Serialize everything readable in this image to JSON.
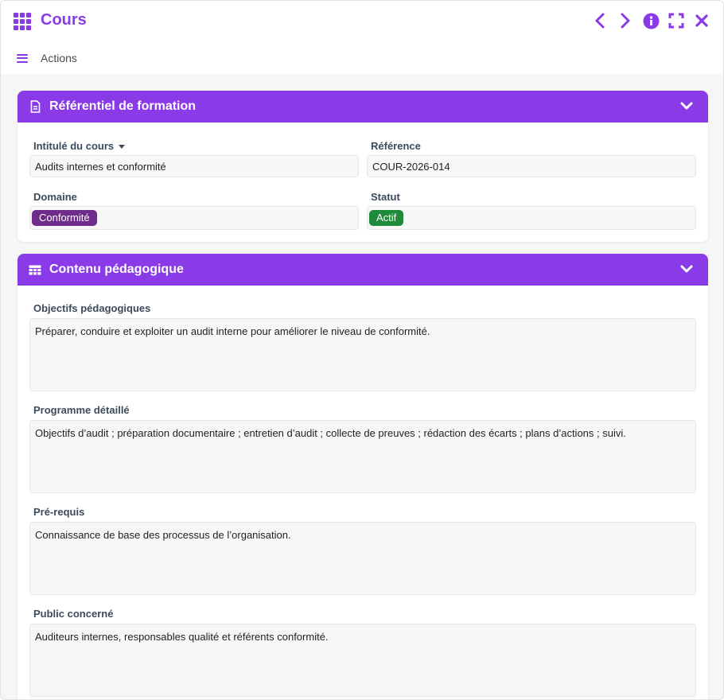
{
  "window": {
    "title": "Cours",
    "accent_color": "#8b3ae8",
    "controls": [
      "chevron-left-icon",
      "chevron-right-icon",
      "info-icon",
      "fullscreen-icon",
      "close-icon"
    ]
  },
  "toolbar": {
    "actions_label": "Actions"
  },
  "section_referentiel": {
    "title": "Référentiel de formation",
    "icon": "document-icon",
    "fields": {
      "intitule": {
        "label": "Intitulé du cours",
        "value": "Audits internes et conformité"
      },
      "reference": {
        "label": "Référence",
        "value": "COUR-2026-014"
      },
      "domaine": {
        "label": "Domaine",
        "value": "Conformité",
        "badge_color": "#6e2d8a"
      },
      "statut": {
        "label": "Statut",
        "value": "Actif",
        "badge_color": "#1e8a3a"
      }
    }
  },
  "section_contenu": {
    "title": "Contenu pédagogique",
    "icon": "table-icon",
    "fields": {
      "objectifs": {
        "label": "Objectifs pédagogiques",
        "value": "Préparer, conduire et exploiter un audit interne pour améliorer le niveau de conformité."
      },
      "programme": {
        "label": "Programme détaillé",
        "value": "Objectifs d’audit ; préparation documentaire ; entretien d’audit ; collecte de preuves ; rédaction des écarts ; plans d’actions ; suivi."
      },
      "prerequis": {
        "label": "Pré-requis",
        "value": "Connaissance de base des processus de l’organisation."
      },
      "public": {
        "label": "Public concerné",
        "value": "Auditeurs internes, responsables qualité et référents conformité."
      }
    }
  }
}
